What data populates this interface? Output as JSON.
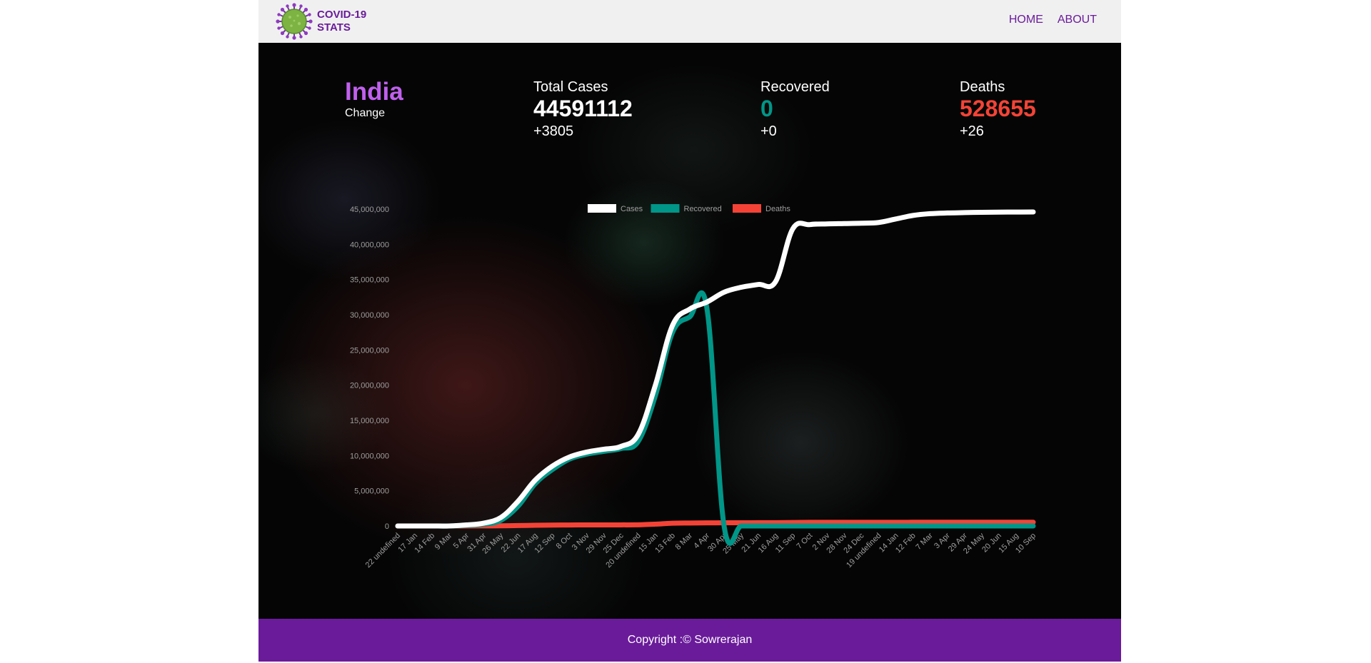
{
  "brand": {
    "line1": "COVID-19",
    "line2": "STATS",
    "icon": "virus-icon"
  },
  "nav": {
    "home": "HOME",
    "about": "ABOUT"
  },
  "country": {
    "name": "India",
    "change_label": "Change"
  },
  "stats": {
    "total_cases": {
      "label": "Total Cases",
      "value": "44591112",
      "delta": "+3805"
    },
    "recovered": {
      "label": "Recovered",
      "value": "0",
      "delta": "+0"
    },
    "deaths": {
      "label": "Deaths",
      "value": "528655",
      "delta": "+26"
    }
  },
  "colors": {
    "brand_purple": "#6a1b9a",
    "country_purple": "#c060ee",
    "cases": "#ffffff",
    "recovered": "#009688",
    "deaths": "#f44336",
    "footer_bg": "#6a1b9a"
  },
  "footer": {
    "text": "Copyright :© Sowrerajan"
  },
  "chart_data": {
    "type": "line",
    "legend_position": "top-center",
    "grid": false,
    "ylim": [
      0,
      45000000
    ],
    "y_ticks": [
      "0",
      "5,000,000",
      "10,000,000",
      "15,000,000",
      "20,000,000",
      "25,000,000",
      "30,000,000",
      "35,000,000",
      "40,000,000",
      "45,000,000"
    ],
    "x_tick_labels": [
      "22 undefined",
      "17 Jan",
      "14 Feb",
      "9 Mar",
      "5 Apr",
      "31 Apr",
      "26 May",
      "22 Jun",
      "17 Aug",
      "12 Sep",
      "8 Oct",
      "3 Nov",
      "29 Nov",
      "25 Dec",
      "20 undefined",
      "15 Jan",
      "13 Feb",
      "8 Mar",
      "4 Apr",
      "30 Apr",
      "25 May",
      "21 Jun",
      "16 Aug",
      "11 Sep",
      "7 Oct",
      "2 Nov",
      "28 Nov",
      "24 Dec",
      "19 undefined",
      "14 Jan",
      "12 Feb",
      "7 Mar",
      "3 Apr",
      "29 Apr",
      "24 May",
      "20 Jun",
      "15 Aug",
      "10 Sep"
    ],
    "series": [
      {
        "name": "Cases",
        "color": "#ffffff",
        "values": [
          0,
          0,
          0,
          0,
          150000,
          400000,
          1200000,
          3500000,
          6500000,
          8500000,
          9800000,
          10500000,
          10900000,
          11300000,
          13000000,
          20000000,
          28500000,
          30800000,
          31800000,
          33200000,
          33900000,
          34300000,
          34700000,
          42200000,
          42800000,
          42900000,
          42950000,
          43000000,
          43100000,
          43600000,
          44100000,
          44350000,
          44450000,
          44500000,
          44550000,
          44570000,
          44580000,
          44591112
        ]
      },
      {
        "name": "Recovered",
        "color": "#009688",
        "values": [
          0,
          0,
          0,
          0,
          100000,
          250000,
          800000,
          2800000,
          6000000,
          8000000,
          9500000,
          10200000,
          10600000,
          11000000,
          12000000,
          18500000,
          27500000,
          29700000,
          30900000,
          0,
          0,
          0,
          0,
          0,
          0,
          0,
          0,
          0,
          0,
          0,
          0,
          0,
          0,
          0,
          0,
          0,
          0,
          0
        ]
      },
      {
        "name": "Deaths",
        "color": "#f44336",
        "values": [
          0,
          0,
          0,
          0,
          5000,
          10000,
          25000,
          60000,
          100000,
          130000,
          145000,
          152000,
          155000,
          158000,
          170000,
          260000,
          390000,
          420000,
          440000,
          450000,
          458000,
          464000,
          470000,
          500000,
          515000,
          520000,
          522000,
          523000,
          524000,
          525000,
          526000,
          527000,
          527500,
          528000,
          528300,
          528500,
          528600,
          528655
        ]
      }
    ]
  }
}
